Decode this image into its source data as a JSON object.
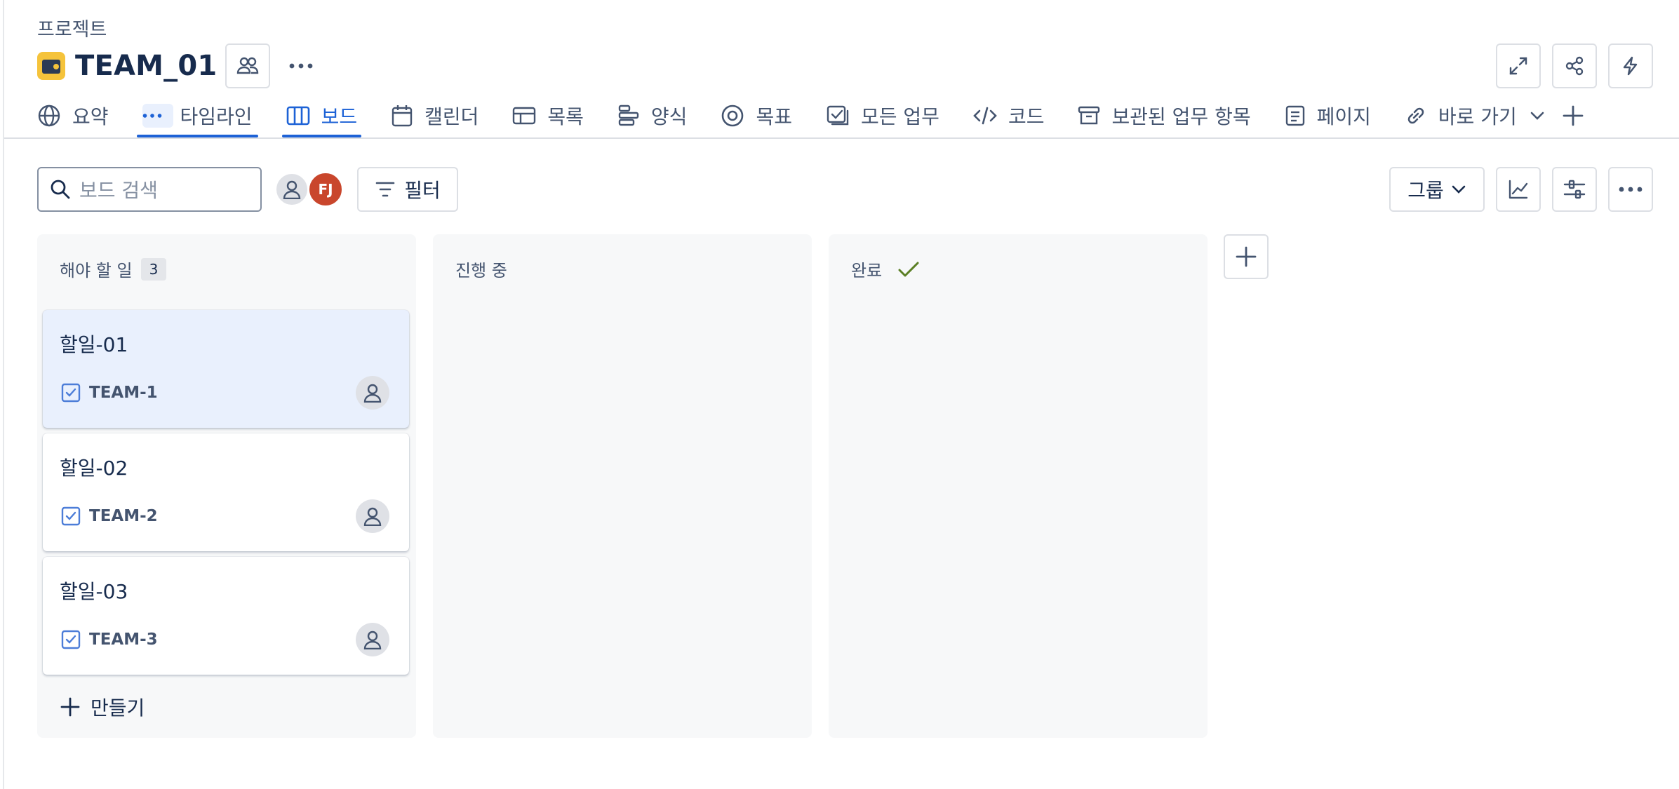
{
  "header": {
    "breadcrumb": "프로젝트",
    "title": "TEAM_01"
  },
  "tabs": [
    {
      "label": "요약",
      "icon": "globe-icon"
    },
    {
      "label": "타임라인",
      "icon": "timeline-dots-icon"
    },
    {
      "label": "보드",
      "icon": "board-icon",
      "active": true
    },
    {
      "label": "캘린더",
      "icon": "calendar-icon"
    },
    {
      "label": "목록",
      "icon": "list-table-icon"
    },
    {
      "label": "양식",
      "icon": "form-icon"
    },
    {
      "label": "목표",
      "icon": "target-icon"
    },
    {
      "label": "모든 업무",
      "icon": "all-work-icon"
    },
    {
      "label": "코드",
      "icon": "code-icon"
    },
    {
      "label": "보관된 업무 항목",
      "icon": "archive-icon"
    },
    {
      "label": "페이지",
      "icon": "page-icon"
    },
    {
      "label": "바로 가기",
      "icon": "link-icon"
    }
  ],
  "toolbar": {
    "search_placeholder": "보드 검색",
    "avatar_initials": "FJ",
    "filter_label": "필터",
    "group_label": "그룹"
  },
  "columns": [
    {
      "title": "해야 할 일",
      "count": "3",
      "cards": [
        {
          "title": "할일-01",
          "key": "TEAM-1"
        },
        {
          "title": "할일-02",
          "key": "TEAM-2"
        },
        {
          "title": "할일-03",
          "key": "TEAM-3"
        }
      ],
      "create_label": "만들기"
    },
    {
      "title": "진행 중",
      "cards": []
    },
    {
      "title": "완료",
      "cards": []
    }
  ],
  "colors": {
    "accent": "#1d62d6",
    "avatar_fj": "#c9462c",
    "done_check": "#5b7f24",
    "selected_card": "#e9f0fd"
  }
}
